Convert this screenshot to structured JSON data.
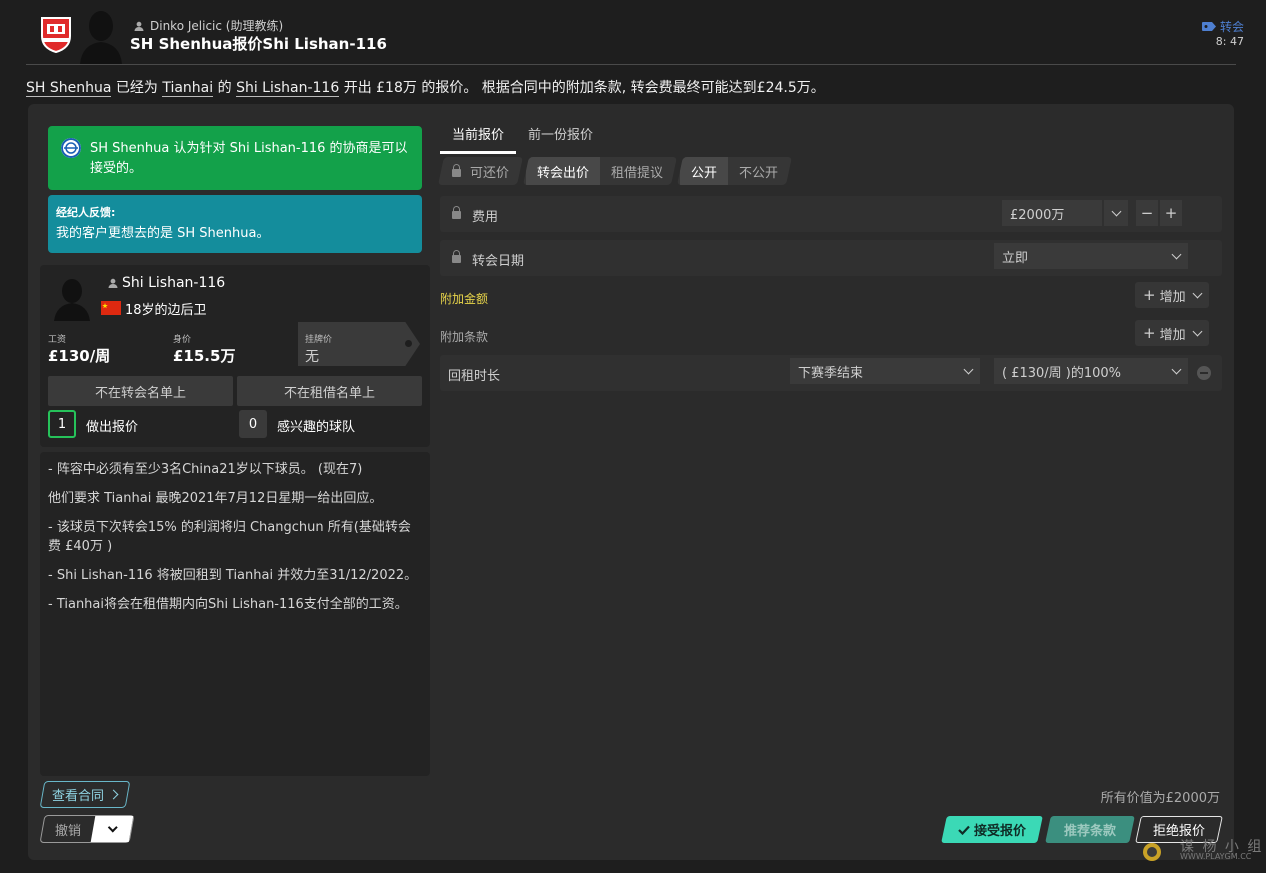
{
  "header": {
    "sender": "Dinko Jelicic (助理教练)",
    "subject": "SH Shenhua报价Shi Lishan-116",
    "category": "转会",
    "time": "8: 47"
  },
  "intro": {
    "club_from": "SH Shenhua",
    "t1": " 已经为 ",
    "club_to": "Tianhai",
    "t2": " 的 ",
    "player": "Shi Lishan-116",
    "t3": " 开出 £18万 的报价。 根据合同中的附加条款, 转会费最终可能达到£24.5万。"
  },
  "messages": {
    "green": "SH Shenhua 认为针对 Shi Lishan-116 的协商是可以接受的。",
    "agent_title": "经纪人反馈:",
    "agent_text": "我的客户更想去的是 SH Shenhua。"
  },
  "player": {
    "name": "Shi Lishan-116",
    "position": "18岁的边后卫",
    "wage_label": "工资",
    "wage": "£130/周",
    "value_label": "身价",
    "value": "£15.5万",
    "asking_label": "挂牌价",
    "asking": "无",
    "transfer_list": "不在转会名单上",
    "loan_list": "不在租借名单上",
    "offers_count": "1",
    "offers_label": "做出报价",
    "interested_count": "0",
    "interested_label": "感兴趣的球队"
  },
  "notes": [
    "- 阵容中必须有至少3名China21岁以下球员。 (现在7)",
    "他们要求 Tianhai 最晚2021年7月12日星期一给出回应。",
    "- 该球员下次转会15% 的利润将归 Changchun 所有(基础转会费 £40万 )",
    "- Shi Lishan-116 将被回租到 Tianhai 并效力至31/12/2022。",
    "- Tianhai将会在租借期内向Shi Lishan-116支付全部的工资。"
  ],
  "actions": {
    "view_contract": "查看合同",
    "undo": "撤销"
  },
  "tabs": {
    "current": "当前报价",
    "previous": "前一份报价"
  },
  "toggles": {
    "counter": "可还价",
    "transfer_offer": "转会出价",
    "loan_offer": "租借提议",
    "public": "公开",
    "private": "不公开"
  },
  "form": {
    "fee_label": "费用",
    "fee_value": "£2000万",
    "date_label": "转会日期",
    "date_value": "立即",
    "add_money_label": "附加金额",
    "add_clause_label": "附加条款",
    "add_button": "增加",
    "loan_back_label": "回租时长",
    "loan_back_duration": "下赛季结束",
    "loan_back_wage": "( £130/周 )的100%"
  },
  "footer": {
    "total": "所有价值为£2000万",
    "accept": "接受报价",
    "recommend": "推荐条款",
    "reject": "拒绝报价",
    "watermark": "谋 杨 小 组",
    "watermark_small": "WWW.PLAYGM.CC"
  },
  "colors": {
    "accent_green": "#13a14a",
    "accent_teal": "#148d9c",
    "accept": "#3bd9b6",
    "link_blue": "#4e7fd0",
    "yellow_label": "#e8d54a"
  }
}
